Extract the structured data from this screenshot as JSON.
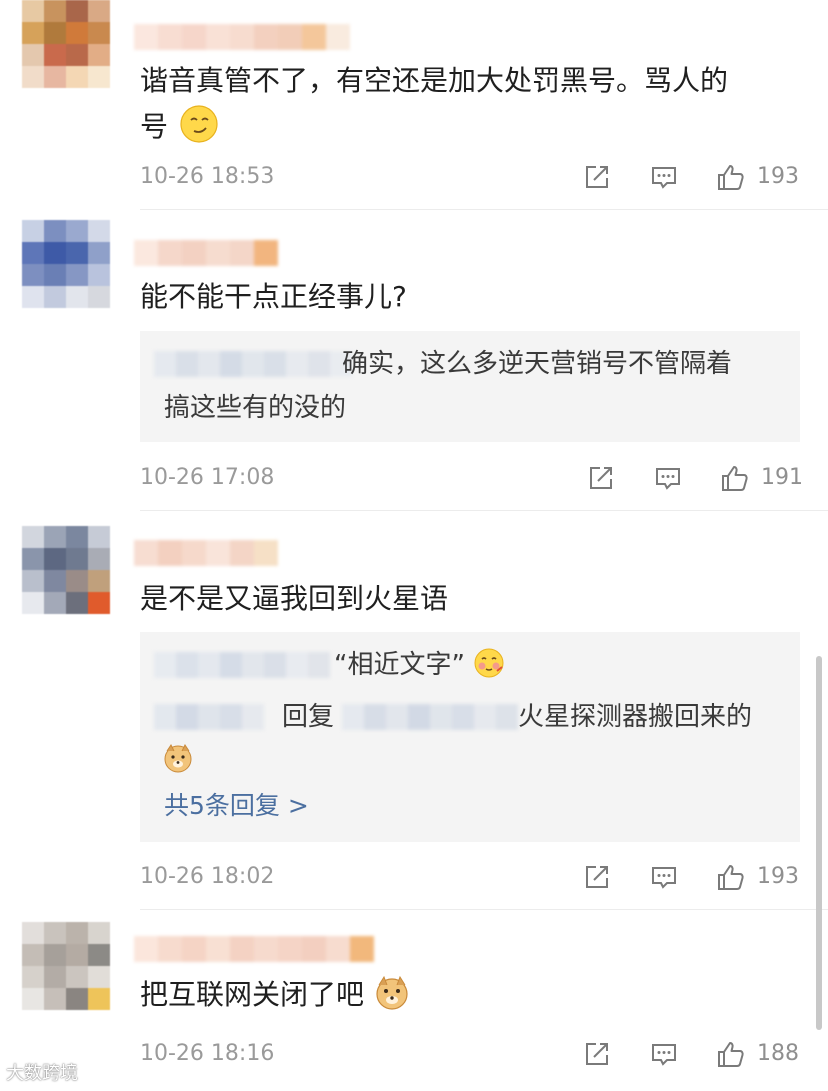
{
  "comments": [
    {
      "text_line1": "谐音真管不了，有空还是加大处罚黑号。骂人的",
      "text_line2": "号",
      "time": "10-26 18:53",
      "likes": "193"
    },
    {
      "text_line1": "能不能干点正经事儿?",
      "reply_line1": "确实，这么多逆天营销号不管隔着",
      "reply_line2": "搞这些有的没的",
      "time": "10-26 17:08",
      "likes": "191"
    },
    {
      "text_line1": "是不是又逼我回到火星语",
      "reply1_text": "“相近文字”",
      "reply2_mid": "回复",
      "reply2_tail": "火星探测器搬回来的",
      "more_replies": "共5条回复 >",
      "time": "10-26 18:02",
      "likes": "193"
    },
    {
      "text_line1": "把互联网关闭了吧",
      "time": "10-26 18:16",
      "likes": "188"
    }
  ],
  "watermark": "大数跨境",
  "icons": {
    "share": "share-icon",
    "comment": "comment-icon",
    "like": "thumbs-up-icon",
    "emoji_smirk": "smirk-emoji-icon",
    "emoji_blush": "blush-emoji-icon",
    "emoji_doge": "doge-emoji-icon"
  },
  "colors": {
    "text": "#1f1f1f",
    "meta": "#9a9a9a",
    "link": "#4b6fa0",
    "reply_bg": "#f4f4f4"
  }
}
